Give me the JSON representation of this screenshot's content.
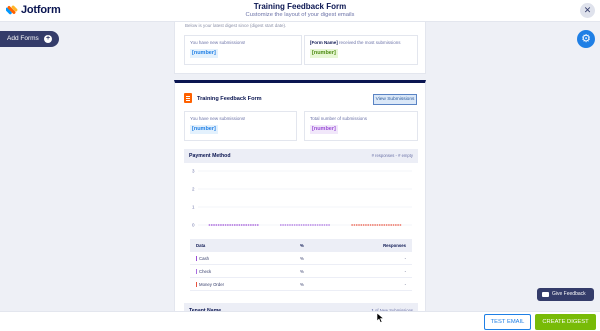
{
  "app": {
    "logo_text": "Jotform"
  },
  "header": {
    "title": "Training Feedback Form",
    "subtitle": "Customize the layout of your digest emails",
    "close_icon": "close-icon"
  },
  "left_panel": {
    "add_forms_label": "Add Forms",
    "add_icon": "plus-icon"
  },
  "settings": {
    "icon": "gear-icon"
  },
  "summary": {
    "note": "Below is your latest digest since (digest start date).",
    "left": {
      "label": "You have new submissions!",
      "chip": "[number]"
    },
    "right": {
      "label_bold": "[Form Name]",
      "label_rest": " received the most submissions",
      "chip": "[number]"
    }
  },
  "form_card": {
    "title": "Training Feedback Form",
    "view_button": "View Submissions",
    "new_label": "You have new submissions!",
    "new_chip": "[number]",
    "total_label": "Total number of submissions",
    "total_chip": "[number]"
  },
  "payment": {
    "title": "Payment Method",
    "meta": "# responses - # empty",
    "chart_data": {
      "type": "bar",
      "categories": [
        "Cash",
        "Check",
        "Money Order"
      ],
      "y_ticks": [
        "0",
        "1",
        "2",
        "3"
      ],
      "ylim": [
        0,
        3
      ],
      "colors": [
        "#9a4dd6",
        "#a86ee0",
        "#e8523f"
      ],
      "grid": true
    },
    "table": {
      "headers": [
        "Data",
        "%",
        "Responses"
      ],
      "rows": [
        {
          "name": "Cash",
          "pct": "%",
          "resp": "-",
          "color": "#9a4dd6"
        },
        {
          "name": "Check",
          "pct": "%",
          "resp": "-",
          "color": "#a86ee0"
        },
        {
          "name": "Money Order",
          "pct": "%",
          "resp": "-",
          "color": "#e8523f"
        }
      ]
    }
  },
  "tenant": {
    "title": "Tenant Name",
    "count": "1",
    "count_suffix": " of New Submissions"
  },
  "footer": {
    "test_email": "TEST EMAIL",
    "create_digest": "CREATE DIGEST"
  },
  "feedback": {
    "label": "Give Feedback",
    "icon": "chat-icon"
  }
}
